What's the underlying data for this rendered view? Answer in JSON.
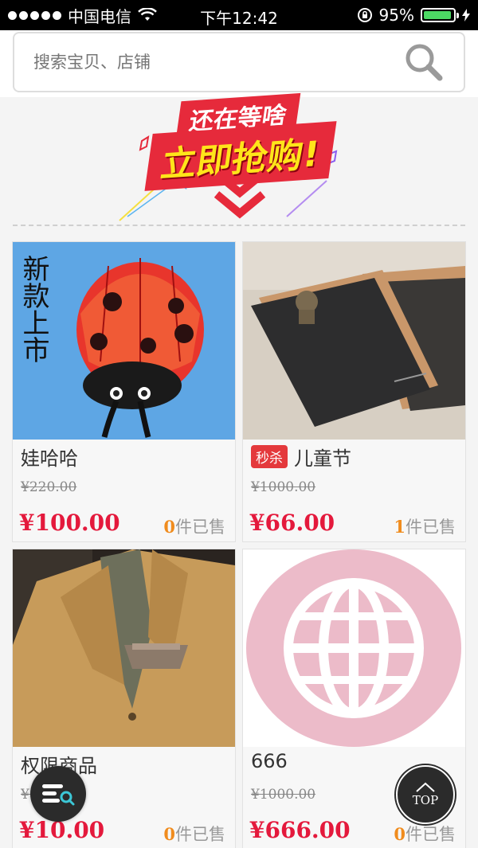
{
  "status_bar": {
    "carrier": "中国电信",
    "time": "下午12:42",
    "battery": "95%",
    "battery_level": 0.95
  },
  "search": {
    "placeholder": "搜索宝贝、店铺"
  },
  "banner": {
    "line1": "还在等啥",
    "line2": "立即抢购!"
  },
  "products": [
    {
      "title": "娃哈哈",
      "tag": "",
      "image_text": "新款上市",
      "old_price": "¥220.00",
      "price": "¥100.00",
      "sold_count": "0",
      "sold_label": "件已售"
    },
    {
      "title": "儿童节",
      "tag": "秒杀",
      "old_price": "¥1000.00",
      "price": "¥66.00",
      "sold_count": "1",
      "sold_label": "件已售"
    },
    {
      "title": "权限商品",
      "tag": "",
      "old_price": "¥100",
      "price": "¥10.00",
      "sold_count": "0",
      "sold_label": "件已售"
    },
    {
      "title": "666",
      "tag": "",
      "old_price": "¥1000.00",
      "price": "¥666.00",
      "sold_count": "0",
      "sold_label": "件已售"
    }
  ],
  "floating": {
    "top_label": "TOP"
  },
  "colors": {
    "accent_red": "#e4193c",
    "sold_orange": "#f08c1e",
    "battery_green": "#4cd964"
  }
}
